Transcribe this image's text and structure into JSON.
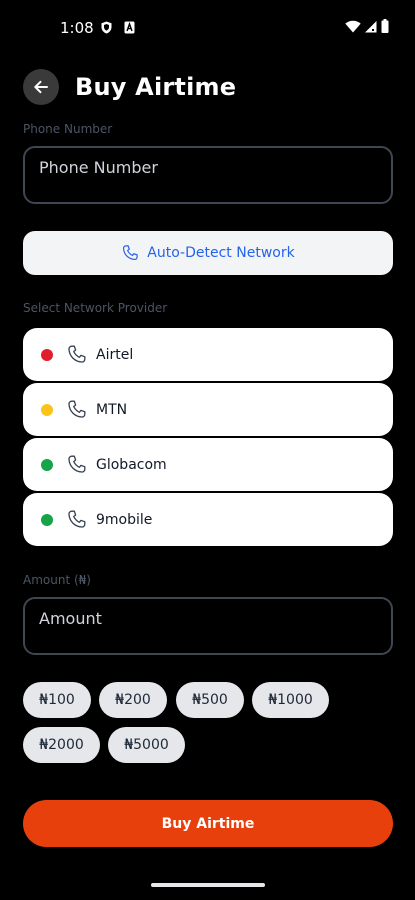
{
  "status_bar": {
    "time": "1:08",
    "icons": [
      "shield-icon",
      "a-icon",
      "wifi-icon",
      "signal-icon",
      "battery-icon"
    ]
  },
  "header": {
    "back_icon": "arrow-left-icon",
    "title": "Buy Airtime"
  },
  "phone": {
    "label": "Phone Number",
    "placeholder": "Phone Number",
    "value": ""
  },
  "auto_detect": {
    "icon": "phone-icon",
    "label": "Auto-Detect Network"
  },
  "network": {
    "label": "Select Network Provider",
    "providers": [
      {
        "name": "Airtel",
        "color": "#e11d2b"
      },
      {
        "name": "MTN",
        "color": "#fcc419"
      },
      {
        "name": "Globacom",
        "color": "#16a34a"
      },
      {
        "name": "9mobile",
        "color": "#16a34a"
      }
    ]
  },
  "amount": {
    "label": "Amount (₦)",
    "placeholder": "Amount",
    "value": "",
    "presets": [
      "₦100",
      "₦200",
      "₦500",
      "₦1000",
      "₦2000",
      "₦5000"
    ]
  },
  "buy_button": {
    "label": "Buy Airtime",
    "color": "#e8400c"
  }
}
